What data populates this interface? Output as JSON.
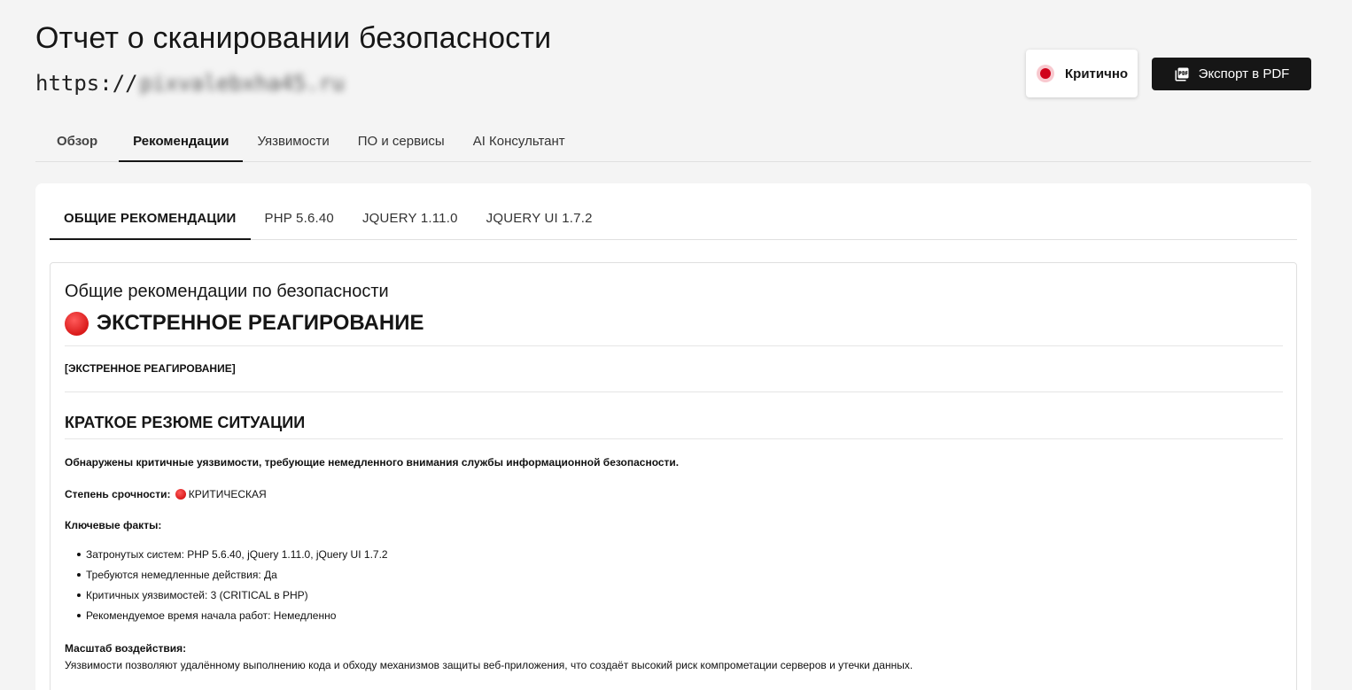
{
  "header": {
    "title": "Отчет о сканировании безопасности",
    "url_prefix": "https://",
    "url_redacted": "pixvalebxha45.ru"
  },
  "severity": {
    "label": "Критично",
    "color": "#d0021b"
  },
  "export": {
    "label": "Экспорт в PDF",
    "icon": "pdf-icon"
  },
  "main_tabs": [
    {
      "label": "Обзор"
    },
    {
      "label": "Рекомендации"
    },
    {
      "label": "Уязвимости"
    },
    {
      "label": "ПО и сервисы"
    },
    {
      "label": "AI Консультант"
    }
  ],
  "main_tabs_active": "Рекомендации",
  "sub_tabs": [
    {
      "label": "ОБЩИЕ РЕКОМЕНДАЦИИ"
    },
    {
      "label": "PHP 5.6.40"
    },
    {
      "label": "JQUERY 1.11.0"
    },
    {
      "label": "JQUERY UI 1.7.2"
    }
  ],
  "sub_tabs_active": "ОБЩИЕ РЕКОМЕНДАЦИИ",
  "recommendations": {
    "title": "Общие рекомендации по безопасности",
    "emergency_heading": "ЭКСТРЕННОЕ РЕАГИРОВАНИЕ",
    "emergency_tag": "[ЭКСТРЕННОЕ РЕАГИРОВАНИЕ]",
    "summary_heading": "КРАТКОЕ РЕЗЮМЕ СИТУАЦИИ",
    "summary_lead": "Обнаружены критичные уязвимости, требующие немедленного внимания службы информационной безопасности.",
    "urgency_label": "Степень срочности:",
    "urgency_value": "КРИТИЧЕСКАЯ",
    "key_facts_label": "Ключевые факты:",
    "key_facts": [
      "Затронутых систем: PHP 5.6.40, jQuery 1.11.0, jQuery UI 1.7.2",
      "Требуются немедленные действия: Да",
      "Критичных уязвимостей: 3 (CRITICAL в PHP)",
      "Рекомендуемое время начала работ: Немедленно"
    ],
    "impact_label": "Масштаб воздействия:",
    "impact_text": "Уязвимости позволяют удалённому выполнению кода и обходу механизмов защиты веб-приложения, что создаёт высокий риск компрометации серверов и утечки данных."
  }
}
